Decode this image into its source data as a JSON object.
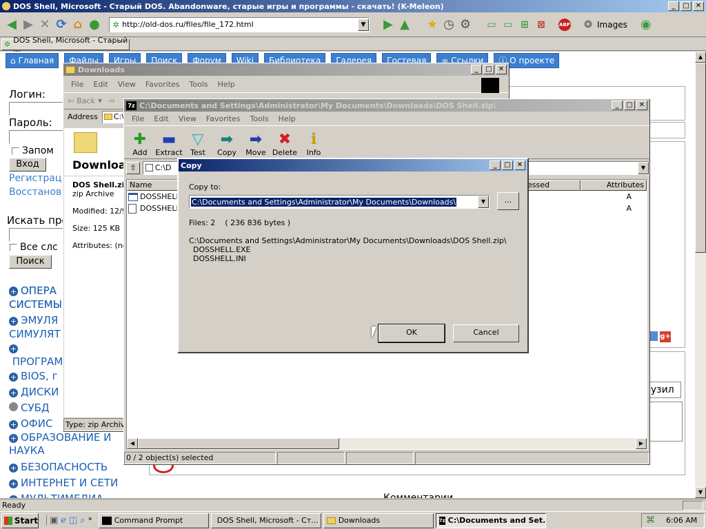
{
  "browser": {
    "title": "DOS Shell, Microsoft - Старый DOS. Abandonware, старые игры и программы - скачать! (K-Meleon)",
    "url": "http://old-dos.ru/files/file_172.html",
    "tab": "DOS Shell, Microsoft - Старый ...",
    "images_label": "Images",
    "status": "Ready"
  },
  "site": {
    "nav": [
      "Главная",
      "Файлы",
      "Игры",
      "Поиск",
      "Форум",
      "Wiki",
      "Библиотека",
      "Галерея",
      "Гостевая",
      "Ссылки",
      "О проекте"
    ],
    "login_label": "Логин:",
    "password_label": "Пароль:",
    "remember_label": "Запом",
    "login_button": "Вход",
    "register_link": "Регистрац",
    "restore_link": "Восстанов",
    "search_label": "Искать про",
    "all_words_label": "Все слс",
    "search_button": "Поиск",
    "categories": [
      "ОПЕРА СИСТЕМЫ",
      "ЭМУЛЯ СИМУЛЯТ",
      "ПРОГРАМ",
      "BIOS, г",
      "ДИСКИ",
      "СУБД",
      "ОФИС",
      "ОБРАЗОВАНИЕ И НАУКА",
      "БЕЗОПАСНОСТЬ",
      "ИНТЕРНЕТ И СЕТИ",
      "МУЛЬТИМЕДИА"
    ],
    "comments_label": "Комментарии",
    "upload_label": "рузил"
  },
  "explorer": {
    "title": "Downloads",
    "menu": [
      "File",
      "Edit",
      "View",
      "Favorites",
      "Tools",
      "Help"
    ],
    "back_label": "Back",
    "address_label": "Address",
    "address_value": "C:\\",
    "folder_title": "Downloa",
    "file_name": "DOS Shell.zip",
    "file_type": "zip Archive",
    "modified": "Modified: 12/9/",
    "size": "Size: 125 KB",
    "attributes": "Attributes: (no",
    "status": "Type: zip Archive"
  },
  "sevenzip": {
    "title": "C:\\Documents and Settings\\Administrator\\My Documents\\Downloads\\DOS Shell.zip\\",
    "menu": [
      "File",
      "Edit",
      "View",
      "Favorites",
      "Tools",
      "Help"
    ],
    "toolbar": [
      "Add",
      "Extract",
      "Test",
      "Copy",
      "Move",
      "Delete",
      "Info"
    ],
    "path_value": "C:\\D",
    "col_name": "Name",
    "col_compressed": "essed",
    "col_attributes": "Attributes",
    "files": [
      {
        "name": "DOSSHELL.",
        "attr": "A"
      },
      {
        "name": "DOSSHELL.",
        "attr": "A"
      }
    ],
    "status": "0 / 2 object(s) selected"
  },
  "copy_dialog": {
    "title": "Copy",
    "copy_to_label": "Copy to:",
    "destination": "C:\\Documents and Settings\\Administrator\\My Documents\\Downloads\\",
    "browse_label": "...",
    "files_info": "Files: 2    ( 236 836 bytes )",
    "source_path": "C:\\Documents and Settings\\Administrator\\My Documents\\Downloads\\DOS Shell.zip\\",
    "file_list": [
      "DOSSHELL.EXE",
      "DOSSHELL.INI"
    ],
    "ok_label": "OK",
    "cancel_label": "Cancel"
  },
  "taskbar": {
    "start_label": "Start",
    "tasks": [
      "Command Prompt",
      "DOS Shell, Microsoft - Ст...",
      "Downloads",
      "C:\\Documents and Set..."
    ],
    "time": "6:06 AM"
  },
  "colors": {
    "title_active": "#0a246a",
    "title_gradient_end": "#a6caf0",
    "chrome": "#d4d0c8",
    "site_link": "#1a5fb4",
    "nav_button": "#3b7fd0",
    "selection": "#0a246a"
  }
}
